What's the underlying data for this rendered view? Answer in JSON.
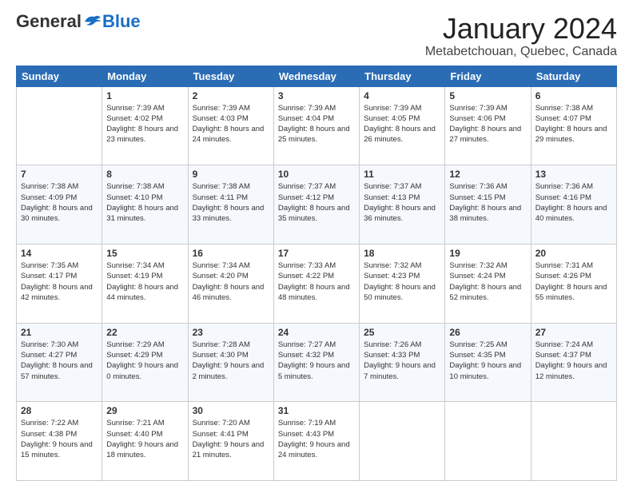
{
  "logo": {
    "general": "General",
    "blue": "Blue"
  },
  "title": "January 2024",
  "subtitle": "Metabetchouan, Quebec, Canada",
  "weekdays": [
    "Sunday",
    "Monday",
    "Tuesday",
    "Wednesday",
    "Thursday",
    "Friday",
    "Saturday"
  ],
  "weeks": [
    [
      {
        "day": "",
        "sunrise": "",
        "sunset": "",
        "daylight": ""
      },
      {
        "day": "1",
        "sunrise": "Sunrise: 7:39 AM",
        "sunset": "Sunset: 4:02 PM",
        "daylight": "Daylight: 8 hours and 23 minutes."
      },
      {
        "day": "2",
        "sunrise": "Sunrise: 7:39 AM",
        "sunset": "Sunset: 4:03 PM",
        "daylight": "Daylight: 8 hours and 24 minutes."
      },
      {
        "day": "3",
        "sunrise": "Sunrise: 7:39 AM",
        "sunset": "Sunset: 4:04 PM",
        "daylight": "Daylight: 8 hours and 25 minutes."
      },
      {
        "day": "4",
        "sunrise": "Sunrise: 7:39 AM",
        "sunset": "Sunset: 4:05 PM",
        "daylight": "Daylight: 8 hours and 26 minutes."
      },
      {
        "day": "5",
        "sunrise": "Sunrise: 7:39 AM",
        "sunset": "Sunset: 4:06 PM",
        "daylight": "Daylight: 8 hours and 27 minutes."
      },
      {
        "day": "6",
        "sunrise": "Sunrise: 7:38 AM",
        "sunset": "Sunset: 4:07 PM",
        "daylight": "Daylight: 8 hours and 29 minutes."
      }
    ],
    [
      {
        "day": "7",
        "sunrise": "Sunrise: 7:38 AM",
        "sunset": "Sunset: 4:09 PM",
        "daylight": "Daylight: 8 hours and 30 minutes."
      },
      {
        "day": "8",
        "sunrise": "Sunrise: 7:38 AM",
        "sunset": "Sunset: 4:10 PM",
        "daylight": "Daylight: 8 hours and 31 minutes."
      },
      {
        "day": "9",
        "sunrise": "Sunrise: 7:38 AM",
        "sunset": "Sunset: 4:11 PM",
        "daylight": "Daylight: 8 hours and 33 minutes."
      },
      {
        "day": "10",
        "sunrise": "Sunrise: 7:37 AM",
        "sunset": "Sunset: 4:12 PM",
        "daylight": "Daylight: 8 hours and 35 minutes."
      },
      {
        "day": "11",
        "sunrise": "Sunrise: 7:37 AM",
        "sunset": "Sunset: 4:13 PM",
        "daylight": "Daylight: 8 hours and 36 minutes."
      },
      {
        "day": "12",
        "sunrise": "Sunrise: 7:36 AM",
        "sunset": "Sunset: 4:15 PM",
        "daylight": "Daylight: 8 hours and 38 minutes."
      },
      {
        "day": "13",
        "sunrise": "Sunrise: 7:36 AM",
        "sunset": "Sunset: 4:16 PM",
        "daylight": "Daylight: 8 hours and 40 minutes."
      }
    ],
    [
      {
        "day": "14",
        "sunrise": "Sunrise: 7:35 AM",
        "sunset": "Sunset: 4:17 PM",
        "daylight": "Daylight: 8 hours and 42 minutes."
      },
      {
        "day": "15",
        "sunrise": "Sunrise: 7:34 AM",
        "sunset": "Sunset: 4:19 PM",
        "daylight": "Daylight: 8 hours and 44 minutes."
      },
      {
        "day": "16",
        "sunrise": "Sunrise: 7:34 AM",
        "sunset": "Sunset: 4:20 PM",
        "daylight": "Daylight: 8 hours and 46 minutes."
      },
      {
        "day": "17",
        "sunrise": "Sunrise: 7:33 AM",
        "sunset": "Sunset: 4:22 PM",
        "daylight": "Daylight: 8 hours and 48 minutes."
      },
      {
        "day": "18",
        "sunrise": "Sunrise: 7:32 AM",
        "sunset": "Sunset: 4:23 PM",
        "daylight": "Daylight: 8 hours and 50 minutes."
      },
      {
        "day": "19",
        "sunrise": "Sunrise: 7:32 AM",
        "sunset": "Sunset: 4:24 PM",
        "daylight": "Daylight: 8 hours and 52 minutes."
      },
      {
        "day": "20",
        "sunrise": "Sunrise: 7:31 AM",
        "sunset": "Sunset: 4:26 PM",
        "daylight": "Daylight: 8 hours and 55 minutes."
      }
    ],
    [
      {
        "day": "21",
        "sunrise": "Sunrise: 7:30 AM",
        "sunset": "Sunset: 4:27 PM",
        "daylight": "Daylight: 8 hours and 57 minutes."
      },
      {
        "day": "22",
        "sunrise": "Sunrise: 7:29 AM",
        "sunset": "Sunset: 4:29 PM",
        "daylight": "Daylight: 9 hours and 0 minutes."
      },
      {
        "day": "23",
        "sunrise": "Sunrise: 7:28 AM",
        "sunset": "Sunset: 4:30 PM",
        "daylight": "Daylight: 9 hours and 2 minutes."
      },
      {
        "day": "24",
        "sunrise": "Sunrise: 7:27 AM",
        "sunset": "Sunset: 4:32 PM",
        "daylight": "Daylight: 9 hours and 5 minutes."
      },
      {
        "day": "25",
        "sunrise": "Sunrise: 7:26 AM",
        "sunset": "Sunset: 4:33 PM",
        "daylight": "Daylight: 9 hours and 7 minutes."
      },
      {
        "day": "26",
        "sunrise": "Sunrise: 7:25 AM",
        "sunset": "Sunset: 4:35 PM",
        "daylight": "Daylight: 9 hours and 10 minutes."
      },
      {
        "day": "27",
        "sunrise": "Sunrise: 7:24 AM",
        "sunset": "Sunset: 4:37 PM",
        "daylight": "Daylight: 9 hours and 12 minutes."
      }
    ],
    [
      {
        "day": "28",
        "sunrise": "Sunrise: 7:22 AM",
        "sunset": "Sunset: 4:38 PM",
        "daylight": "Daylight: 9 hours and 15 minutes."
      },
      {
        "day": "29",
        "sunrise": "Sunrise: 7:21 AM",
        "sunset": "Sunset: 4:40 PM",
        "daylight": "Daylight: 9 hours and 18 minutes."
      },
      {
        "day": "30",
        "sunrise": "Sunrise: 7:20 AM",
        "sunset": "Sunset: 4:41 PM",
        "daylight": "Daylight: 9 hours and 21 minutes."
      },
      {
        "day": "31",
        "sunrise": "Sunrise: 7:19 AM",
        "sunset": "Sunset: 4:43 PM",
        "daylight": "Daylight: 9 hours and 24 minutes."
      },
      {
        "day": "",
        "sunrise": "",
        "sunset": "",
        "daylight": ""
      },
      {
        "day": "",
        "sunrise": "",
        "sunset": "",
        "daylight": ""
      },
      {
        "day": "",
        "sunrise": "",
        "sunset": "",
        "daylight": ""
      }
    ]
  ]
}
